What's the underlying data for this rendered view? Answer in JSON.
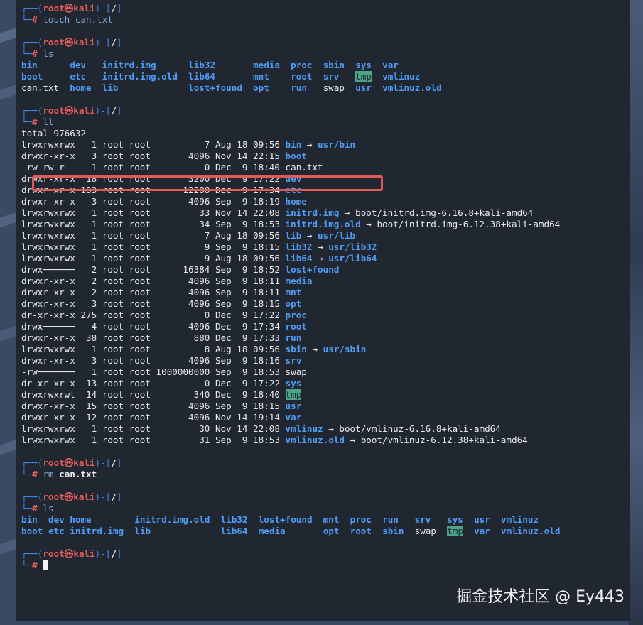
{
  "blocks": [
    {
      "type": "prompt",
      "user": "root",
      "host": "kali",
      "path": "/",
      "cmd": "touch can.txt",
      "cmd_class": "c-cmd"
    },
    {
      "type": "rows",
      "rows": [
        [
          {
            "t": "bin",
            "c": "dir",
            "w": 9
          },
          {
            "t": "dev",
            "c": "dir",
            "w": 6
          },
          {
            "t": "initrd.img",
            "c": "dir",
            "w": 16
          },
          {
            "t": "lib32",
            "c": "dir",
            "w": 12
          },
          {
            "t": "media",
            "c": "dir",
            "w": 7
          },
          {
            "t": "proc",
            "c": "dir",
            "w": 6
          },
          {
            "t": "sbin",
            "c": "dir",
            "w": 6
          },
          {
            "t": "sys",
            "c": "dir",
            "w": 5
          },
          {
            "t": "var",
            "c": "dir"
          }
        ],
        [
          {
            "t": "boot",
            "c": "dir",
            "w": 9
          },
          {
            "t": "etc",
            "c": "dir",
            "w": 6
          },
          {
            "t": "initrd.img.old",
            "c": "dir",
            "w": 16
          },
          {
            "t": "lib64",
            "c": "dir",
            "w": 12
          },
          {
            "t": "mnt",
            "c": "dir",
            "w": 7
          },
          {
            "t": "root",
            "c": "dir",
            "w": 6
          },
          {
            "t": "srv",
            "c": "dir",
            "w": 6
          },
          {
            "t": "tmp",
            "c": "hl",
            "w": 5
          },
          {
            "t": "vmlinuz",
            "c": "dir"
          }
        ],
        [
          {
            "t": "can.txt",
            "c": "",
            "w": 9
          },
          {
            "t": "home",
            "c": "dir",
            "w": 6
          },
          {
            "t": "lib",
            "c": "dir",
            "w": 16
          },
          {
            "t": "lost+found",
            "c": "dir",
            "w": 12
          },
          {
            "t": "opt",
            "c": "dir",
            "w": 7
          },
          {
            "t": "run",
            "c": "dir",
            "w": 6
          },
          {
            "t": "swap",
            "c": "",
            "w": 6
          },
          {
            "t": "usr",
            "c": "dir",
            "w": 5
          },
          {
            "t": "vmlinuz.old",
            "c": "dir"
          }
        ]
      ],
      "precmd": "ls"
    },
    {
      "type": "ll",
      "precmd": "ll",
      "total": "total 976632",
      "rows": [
        {
          "p": "lrwxrwxrwx   1 root root          7 Aug 18 09:56 ",
          "n": "bin",
          "nc": "dir",
          "arrow": " → ",
          "t": "usr/bin",
          "tc": "dir"
        },
        {
          "p": "drwxr-xr-x   3 root root       4096 Nov 14 22:15 ",
          "n": "boot",
          "nc": "dir"
        },
        {
          "p": "-rw-rw-r--   1 root root          0 Dec  9 18:40 ",
          "n": "can.txt",
          "nc": ""
        },
        {
          "p": "drwxr-xr-x  18 root root       3200 Dec  9 17:22 ",
          "n": "dev",
          "nc": "dir"
        },
        {
          "p": "drwxr-xr-x 183 root root      12288 Dec  9 17:34 ",
          "n": "etc",
          "nc": "dir"
        },
        {
          "p": "drwxr-xr-x   3 root root       4096 Sep  9 18:19 ",
          "n": "home",
          "nc": "dir"
        },
        {
          "p": "lrwxrwxrwx   1 root root         33 Nov 14 22:08 ",
          "n": "initrd.img",
          "nc": "dir",
          "arrow": " → ",
          "t": "boot/initrd.img-6.16.8+kali-amd64",
          "tc": ""
        },
        {
          "p": "lrwxrwxrwx   1 root root         34 Sep  9 18:53 ",
          "n": "initrd.img.old",
          "nc": "dir",
          "arrow": " → ",
          "t": "boot/initrd.img-6.12.38+kali-amd64",
          "tc": ""
        },
        {
          "p": "lrwxrwxrwx   1 root root          7 Aug 18 09:56 ",
          "n": "lib",
          "nc": "dir",
          "arrow": " → ",
          "t": "usr/lib",
          "tc": "dir"
        },
        {
          "p": "lrwxrwxrwx   1 root root          9 Sep  9 18:15 ",
          "n": "lib32",
          "nc": "dir",
          "arrow": " → ",
          "t": "usr/lib32",
          "tc": "dir"
        },
        {
          "p": "lrwxrwxrwx   1 root root          9 Aug 18 09:56 ",
          "n": "lib64",
          "nc": "dir",
          "arrow": " → ",
          "t": "usr/lib64",
          "tc": "dir"
        },
        {
          "p": "drwx──────   2 root root      16384 Sep  9 18:52 ",
          "n": "lost+found",
          "nc": "dir"
        },
        {
          "p": "drwxr-xr-x   2 root root       4096 Sep  9 18:11 ",
          "n": "media",
          "nc": "dir"
        },
        {
          "p": "drwxr-xr-x   2 root root       4096 Sep  9 18:11 ",
          "n": "mnt",
          "nc": "dir"
        },
        {
          "p": "drwxr-xr-x   3 root root       4096 Sep  9 18:15 ",
          "n": "opt",
          "nc": "dir"
        },
        {
          "p": "dr-xr-xr-x 275 root root          0 Dec  9 17:22 ",
          "n": "proc",
          "nc": "dir"
        },
        {
          "p": "drwx──────   4 root root       4096 Dec  9 17:34 ",
          "n": "root",
          "nc": "dir"
        },
        {
          "p": "drwxr-xr-x  38 root root        880 Dec  9 17:33 ",
          "n": "run",
          "nc": "dir"
        },
        {
          "p": "lrwxrwxrwx   1 root root          8 Aug 18 09:56 ",
          "n": "sbin",
          "nc": "dir",
          "arrow": " → ",
          "t": "usr/sbin",
          "tc": "dir"
        },
        {
          "p": "drwxr-xr-x   3 root root       4096 Sep  9 18:16 ",
          "n": "srv",
          "nc": "dir"
        },
        {
          "p": "-rw───────   1 root root 1000000000 Sep  9 18:53 ",
          "n": "swap",
          "nc": ""
        },
        {
          "p": "dr-xr-xr-x  13 root root          0 Dec  9 17:22 ",
          "n": "sys",
          "nc": "dir"
        },
        {
          "p": "drwxrwxrwt  14 root root        340 Dec  9 18:40 ",
          "n": "tmp",
          "nc": "hl"
        },
        {
          "p": "drwxr-xr-x  15 root root       4096 Sep  9 18:15 ",
          "n": "usr",
          "nc": "dir"
        },
        {
          "p": "drwxr-xr-x  12 root root       4096 Nov 14 19:14 ",
          "n": "var",
          "nc": "dir"
        },
        {
          "p": "lrwxrwxrwx   1 root root         30 Nov 14 22:08 ",
          "n": "vmlinuz",
          "nc": "dir",
          "arrow": " → ",
          "t": "boot/vmlinuz-6.16.8+kali-amd64",
          "tc": ""
        },
        {
          "p": "lrwxrwxrwx   1 root root         31 Sep  9 18:53 ",
          "n": "vmlinuz.old",
          "nc": "dir",
          "arrow": " → ",
          "t": "boot/vmlinuz-6.12.38+kali-amd64",
          "tc": ""
        }
      ]
    },
    {
      "type": "prompt",
      "user": "root",
      "host": "kali",
      "path": "/",
      "cmd": "rm",
      "arg": "can.txt",
      "cmd_class": "c-cmd"
    },
    {
      "type": "rows",
      "precmd": "ls",
      "rows": [
        [
          {
            "t": "bin",
            "c": "dir",
            "w": 5
          },
          {
            "t": "dev",
            "c": "dir",
            "w": 4
          },
          {
            "t": "home",
            "c": "dir",
            "w": 12
          },
          {
            "t": "initrd.img.old",
            "c": "dir",
            "w": 16
          },
          {
            "t": "lib32",
            "c": "dir",
            "w": 7
          },
          {
            "t": "lost+found",
            "c": "dir",
            "w": 12
          },
          {
            "t": "mnt",
            "c": "dir",
            "w": 5
          },
          {
            "t": "proc",
            "c": "dir",
            "w": 6
          },
          {
            "t": "run",
            "c": "dir",
            "w": 6
          },
          {
            "t": "srv",
            "c": "dir",
            "w": 6
          },
          {
            "t": "sys",
            "c": "dir",
            "w": 5
          },
          {
            "t": "usr",
            "c": "dir",
            "w": 5
          },
          {
            "t": "vmlinuz",
            "c": "dir"
          }
        ],
        [
          {
            "t": "boot",
            "c": "dir",
            "w": 5
          },
          {
            "t": "etc",
            "c": "dir",
            "w": 4
          },
          {
            "t": "initrd.img",
            "c": "dir",
            "w": 12
          },
          {
            "t": "lib",
            "c": "dir",
            "w": 16
          },
          {
            "t": "lib64",
            "c": "dir",
            "w": 7
          },
          {
            "t": "media",
            "c": "dir",
            "w": 12
          },
          {
            "t": "opt",
            "c": "dir",
            "w": 5
          },
          {
            "t": "root",
            "c": "dir",
            "w": 6
          },
          {
            "t": "sbin",
            "c": "dir",
            "w": 6
          },
          {
            "t": "swap",
            "c": "",
            "w": 6
          },
          {
            "t": "tmp",
            "c": "hl",
            "w": 5
          },
          {
            "t": "var",
            "c": "dir",
            "w": 5
          },
          {
            "t": "vmlinuz.old",
            "c": "dir"
          }
        ]
      ]
    },
    {
      "type": "final",
      "user": "root",
      "host": "kali",
      "path": "/"
    }
  ],
  "frame": {
    "top_left": "┌──(",
    "mid": ")-[",
    "end": "]",
    "bottom": "└─",
    "hash": "#",
    "at": "㉿"
  },
  "watermark": "掘金技术社区 @ Ey443"
}
